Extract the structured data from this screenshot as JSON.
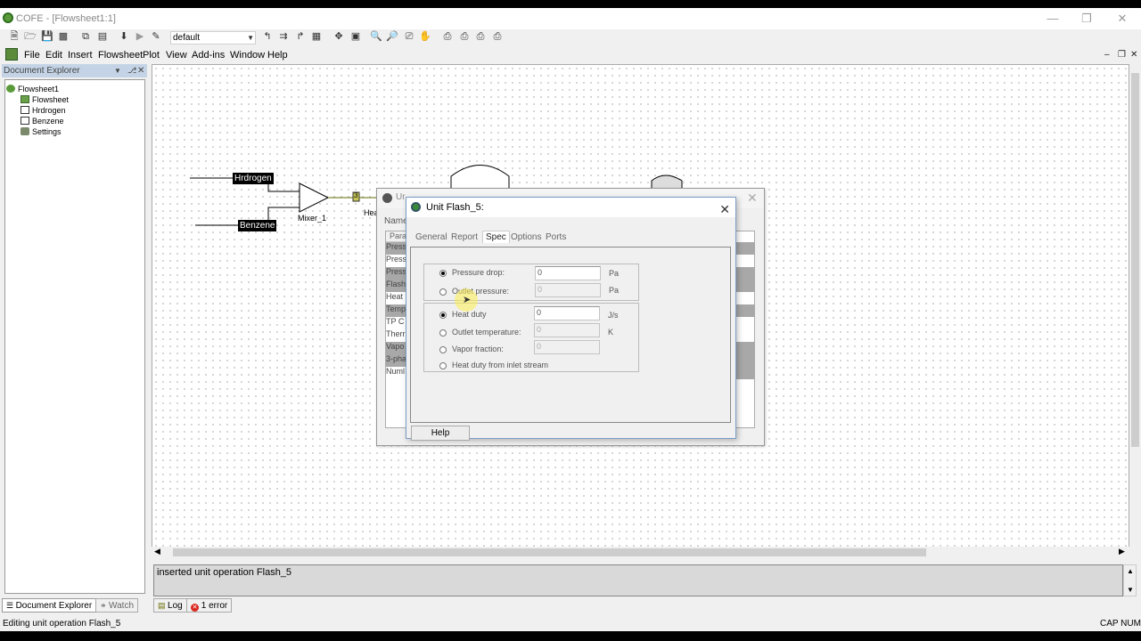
{
  "window": {
    "title": "COFE - [Flowsheet1:1]"
  },
  "toolbar": {
    "scheme": "default"
  },
  "menu": {
    "items": [
      "File",
      "Edit",
      "Insert",
      "Flowsheet",
      "Plot",
      "View",
      "Add-ins",
      "Window",
      "Help"
    ]
  },
  "explorer": {
    "title": "Document Explorer",
    "root": "Flowsheet1",
    "children": [
      "Flowsheet",
      "Hrdrogen",
      "Benzene",
      "Settings"
    ]
  },
  "flowsheet": {
    "streams": {
      "hydrogen": "Hrdrogen",
      "benzene": "Benzene"
    },
    "units": {
      "mixer": "Mixer_1",
      "heater_partial": "Hea",
      "stream_tag": "3"
    }
  },
  "back_dialog": {
    "title_partial": "Ur",
    "column_header": "Name",
    "col_param": "Para",
    "rows": [
      "Press",
      "Press",
      "Press",
      "Flash",
      "Heat",
      "Temp",
      "TP C",
      "Therr",
      "Vapo",
      "3-pha",
      "Numl"
    ]
  },
  "dialog": {
    "title": "Unit Flash_5:",
    "tabs": [
      "General",
      "Report",
      "Spec",
      "Options",
      "Ports"
    ],
    "active_tab": "Spec",
    "pressure_group": [
      {
        "label": "Pressure drop:",
        "value": "0",
        "unit": "Pa",
        "selected": true
      },
      {
        "label": "Outlet pressure:",
        "value": "0",
        "unit": "Pa",
        "selected": false
      }
    ],
    "energy_group": [
      {
        "label": "Heat duty",
        "value": "0",
        "unit": "J/s",
        "selected": true
      },
      {
        "label": "Outlet temperature:",
        "value": "0",
        "unit": "K",
        "selected": false
      },
      {
        "label": "Vapor fraction:",
        "value": "0",
        "unit": "",
        "selected": false
      },
      {
        "label": "Heat duty from inlet stream",
        "value": null,
        "unit": "",
        "selected": false
      }
    ],
    "help_label": "Help"
  },
  "log": {
    "message": "inserted unit operation Flash_5"
  },
  "bottom_tabs": {
    "explorer": "Document Explorer",
    "watch": "Watch",
    "log": "Log",
    "errors": "1 error"
  },
  "status": {
    "text": "Editing unit operation Flash_5",
    "indicators": "CAP NUM"
  },
  "colors": {
    "accent": "#7a9cc6",
    "explorer_header": "#c4d4e6",
    "error": "#d9261c",
    "stream_wire": "#6a6a00"
  }
}
